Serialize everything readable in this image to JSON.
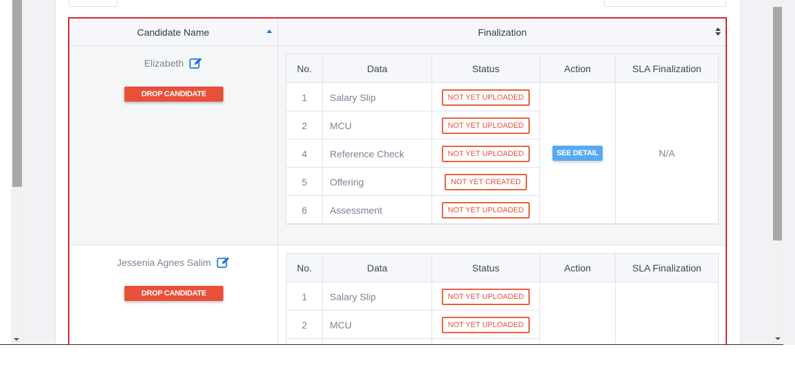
{
  "table": {
    "headers": {
      "candidate_name": "Candidate Name",
      "finalization": "Finalization"
    },
    "inner_headers": {
      "no": "No.",
      "data": "Data",
      "status": "Status",
      "action": "Action",
      "sla": "SLA Finalization"
    }
  },
  "candidates": [
    {
      "name": "Elizabeth",
      "drop_label": "DROP CANDIDATE",
      "action_label": "SEE DETAIL",
      "sla": "N/A",
      "rows": [
        {
          "no": "1",
          "data": "Salary Slip",
          "status": "NOT YET UPLOADED"
        },
        {
          "no": "2",
          "data": "MCU",
          "status": "NOT YET UPLOADED"
        },
        {
          "no": "4",
          "data": "Reference Check",
          "status": "NOT YET UPLOADED"
        },
        {
          "no": "5",
          "data": "Offering",
          "status": "NOT YET CREATED"
        },
        {
          "no": "6",
          "data": "Assessment",
          "status": "NOT YET UPLOADED"
        }
      ]
    },
    {
      "name": "Jessenia Agnes Salim",
      "drop_label": "DROP CANDIDATE",
      "rows": [
        {
          "no": "1",
          "data": "Salary Slip",
          "status": "NOT YET UPLOADED"
        },
        {
          "no": "2",
          "data": "MCU",
          "status": "NOT YET UPLOADED"
        }
      ]
    }
  ],
  "colors": {
    "drop": "#e8503a",
    "status_border": "#e8603f",
    "see_detail": "#58a8f5",
    "highlight_frame": "#d9262c"
  }
}
